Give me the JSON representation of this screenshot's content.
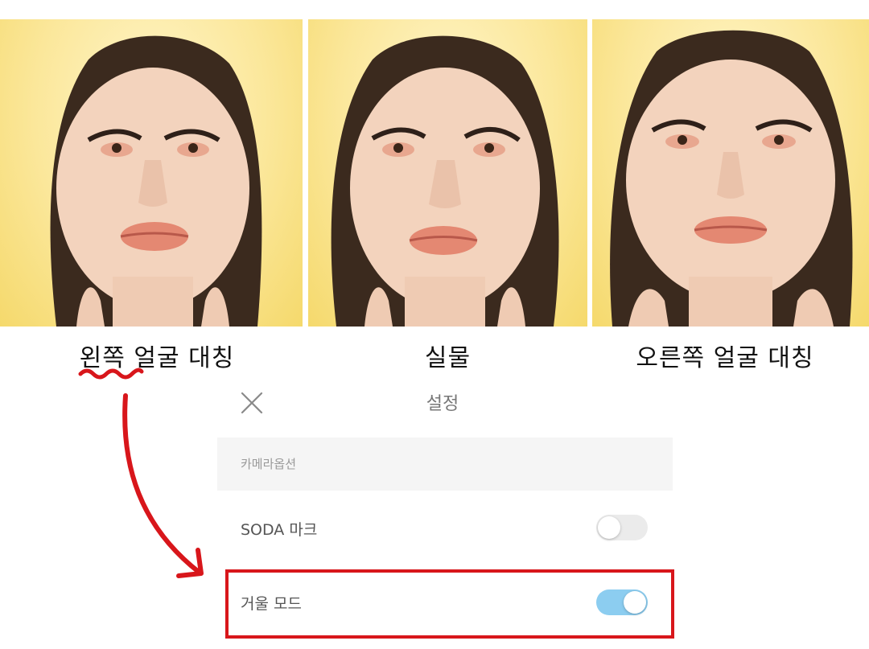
{
  "captions": {
    "left": "왼쪽 얼굴 대칭",
    "middle": "실물",
    "right": "오른쪽 얼굴 대칭"
  },
  "settings": {
    "title": "설정",
    "section_header": "카메라옵션",
    "rows": [
      {
        "label": "SODA 마크",
        "toggle_on": false
      },
      {
        "label": "거울 모드",
        "toggle_on": true
      }
    ]
  },
  "colors": {
    "photo_background": "#f8e27f",
    "annotation_red": "#d8161b",
    "toggle_on": "#8ccdf0",
    "toggle_off": "#ebebeb"
  },
  "icons": {
    "close": "close-icon"
  }
}
